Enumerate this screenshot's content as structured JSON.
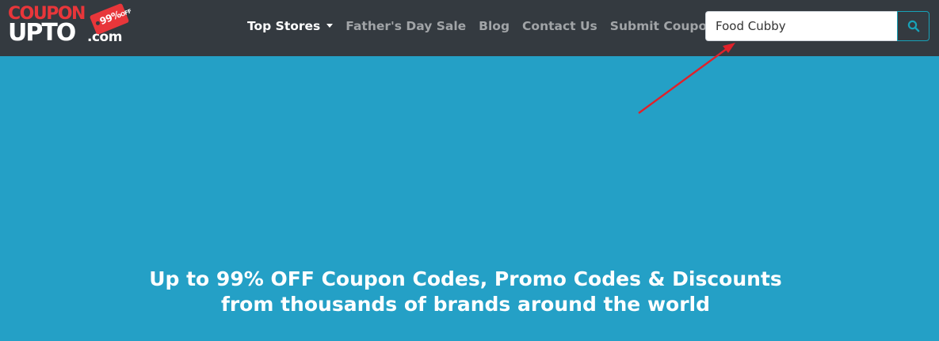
{
  "logo": {
    "word_top": "COUPON",
    "word_bottom": "UPTO",
    "suffix": ".com",
    "tag_number": "99%",
    "tag_off": "OFF"
  },
  "nav": {
    "items": [
      {
        "label": "Top Stores",
        "active": true,
        "has_dropdown": true
      },
      {
        "label": "Father's Day Sale"
      },
      {
        "label": "Blog"
      },
      {
        "label": "Contact Us"
      },
      {
        "label": "Submit Coupon"
      }
    ]
  },
  "search": {
    "value": "Food Cubby",
    "button_icon": "search-icon"
  },
  "hero": {
    "line1": "Up to 99% OFF Coupon Codes, Promo Codes & Discounts",
    "line2": "from thousands of brands around the world"
  },
  "colors": {
    "navbar_bg": "#343a40",
    "hero_bg": "#24a0c6",
    "accent_red": "#e8363a",
    "search_button_accent": "#17a2b8",
    "annotation_arrow": "#e0212a"
  }
}
